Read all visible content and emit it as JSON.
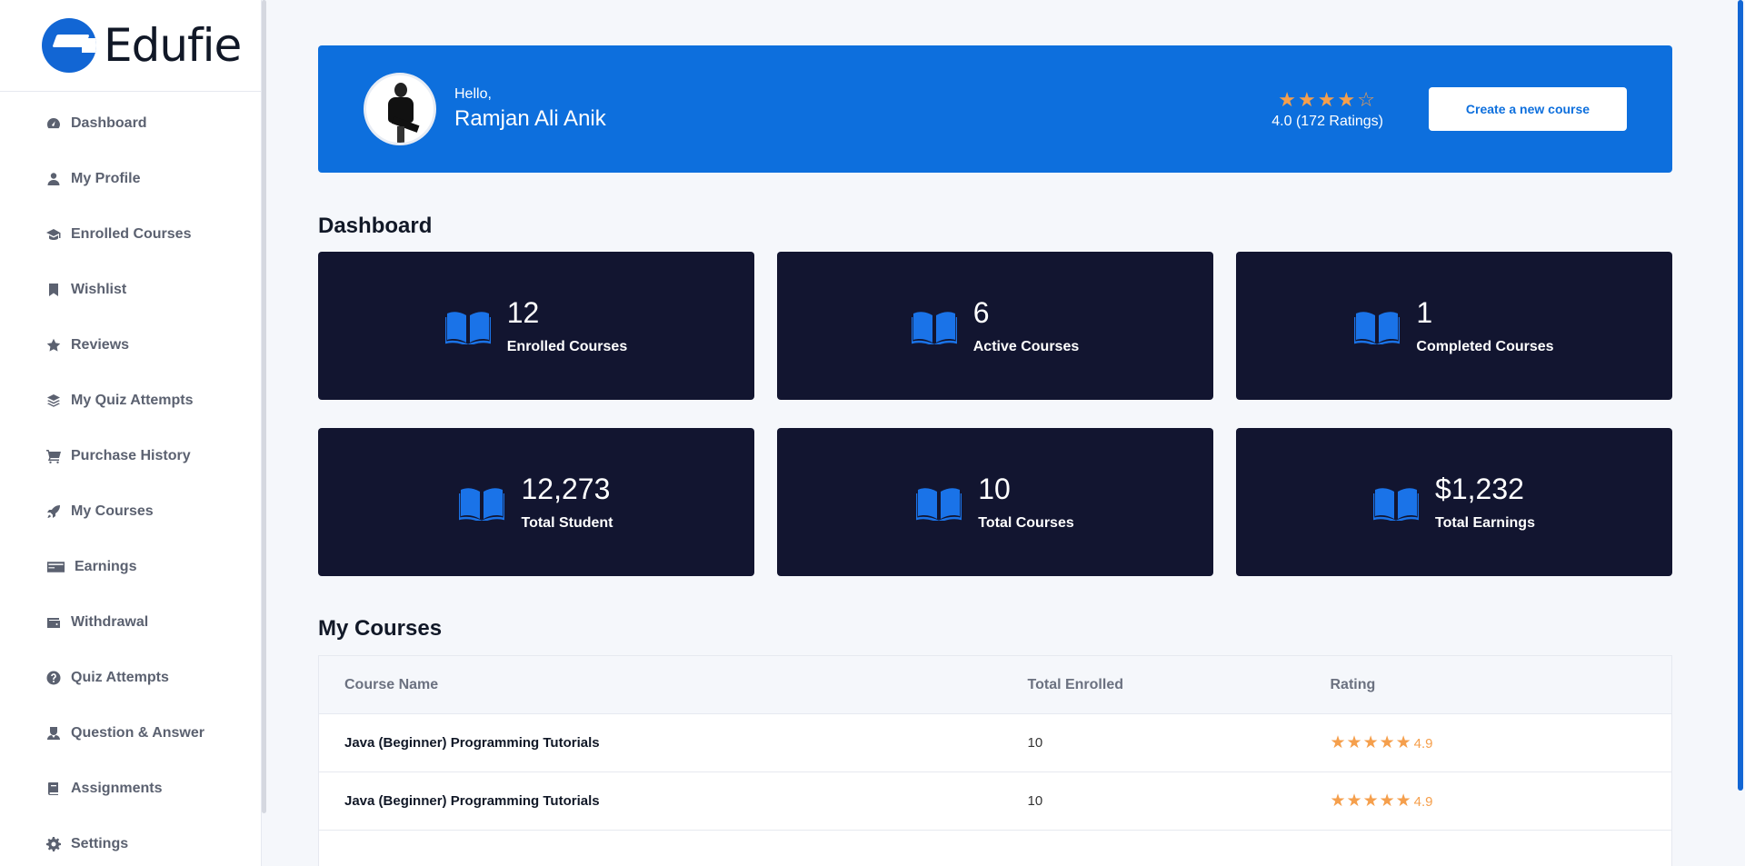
{
  "brand": {
    "name": "Edufie"
  },
  "sidebar": {
    "items": [
      {
        "label": "Dashboard",
        "icon": "gauge-icon"
      },
      {
        "label": "My Profile",
        "icon": "user-icon"
      },
      {
        "label": "Enrolled Courses",
        "icon": "graduation-cap-icon"
      },
      {
        "label": "Wishlist",
        "icon": "bookmark-icon"
      },
      {
        "label": "Reviews",
        "icon": "star-icon"
      },
      {
        "label": "My Quiz Attempts",
        "icon": "layers-icon"
      },
      {
        "label": "Purchase History",
        "icon": "cart-icon"
      },
      {
        "label": "My Courses",
        "icon": "rocket-icon"
      },
      {
        "label": "Earnings",
        "icon": "credit-card-icon"
      },
      {
        "label": "Withdrawal",
        "icon": "wallet-icon"
      },
      {
        "label": "Quiz Attempts",
        "icon": "question-circle-icon"
      },
      {
        "label": "Question & Answer",
        "icon": "user-tie-icon"
      },
      {
        "label": "Assignments",
        "icon": "book-icon"
      },
      {
        "label": "Settings",
        "icon": "gear-icon"
      }
    ]
  },
  "hero": {
    "greeting": "Hello,",
    "name": "Ramjan Ali Anik",
    "stars_filled": 4,
    "stars_total": 5,
    "rating_text": "4.0 (172 Ratings)",
    "create_label": "Create a new course"
  },
  "dashboard": {
    "title": "Dashboard",
    "stats": [
      {
        "value": "12",
        "label": "Enrolled Courses"
      },
      {
        "value": "6",
        "label": "Active Courses"
      },
      {
        "value": "1",
        "label": "Completed Courses"
      },
      {
        "value": "12,273",
        "label": "Total Student"
      },
      {
        "value": "10",
        "label": "Total Courses"
      },
      {
        "value": "$1,232",
        "label": "Total Earnings"
      }
    ]
  },
  "courses": {
    "title": "My Courses",
    "headers": [
      "Course Name",
      "Total Enrolled",
      "Rating"
    ],
    "rows": [
      {
        "name": "Java (Beginner) Programming Tutorials",
        "enrolled": "10",
        "rating": "4.9"
      },
      {
        "name": "Java (Beginner) Programming Tutorials",
        "enrolled": "10",
        "rating": "4.9"
      }
    ]
  },
  "colors": {
    "primary": "#0d6fdd",
    "card": "#121530",
    "star": "#f59f4c"
  }
}
